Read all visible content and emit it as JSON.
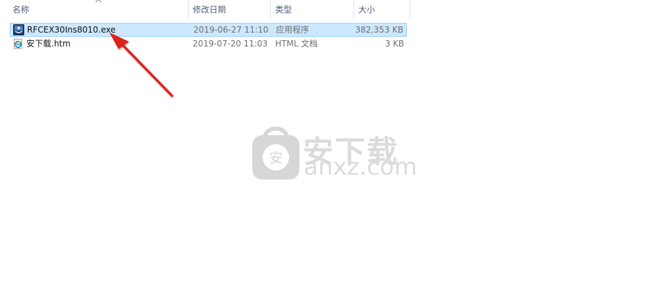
{
  "columns": {
    "name": "名称",
    "modified": "修改日期",
    "type": "类型",
    "size": "大小"
  },
  "files": [
    {
      "name": "RFCEX30Ins8010.exe",
      "modified": "2019-06-27 11:10",
      "type": "应用程序",
      "size": "382,353 KB",
      "icon": "installer-exe-icon",
      "selected": true
    },
    {
      "name": "安下载.htm",
      "modified": "2019-07-20 11:03",
      "type": "HTML 文档",
      "size": "3 KB",
      "icon": "ie-html-icon",
      "selected": false
    }
  ],
  "watermark": {
    "chinese": "安下载",
    "domain": "anxz.com",
    "badge": "安"
  },
  "colors": {
    "selection_bg": "#cce8ff",
    "selection_border": "#99d1ff",
    "arrow": "#e0201f",
    "header_text": "#4c607a"
  }
}
